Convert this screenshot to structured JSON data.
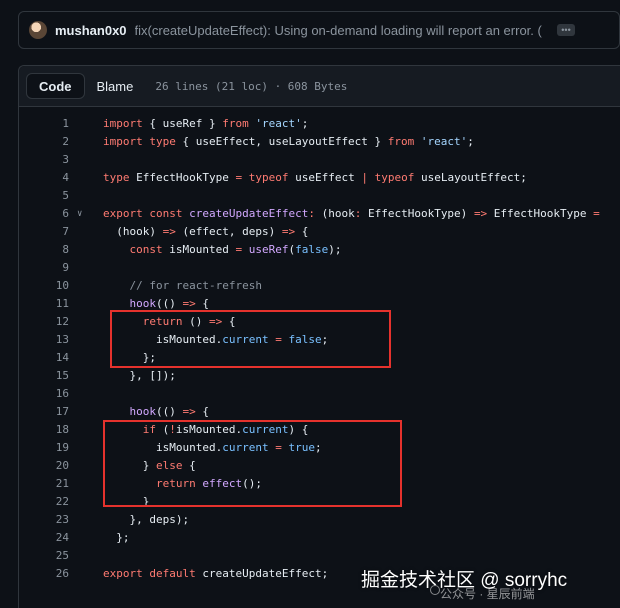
{
  "commit": {
    "author": "mushan0x0",
    "message": "fix(createUpdateEffect): Using on-demand loading will report an error. (",
    "more_label": "•••"
  },
  "file": {
    "tabs": [
      {
        "label": "Code",
        "active": true
      },
      {
        "label": "Blame",
        "active": false
      }
    ],
    "meta": "26 lines (21 loc) · 608 Bytes"
  },
  "code": {
    "lines": [
      {
        "n": "1",
        "html": "<span class=\"kw\">import</span> { useRef } <span class=\"kw\">from</span> <span class=\"str\">'react'</span>;"
      },
      {
        "n": "2",
        "html": "<span class=\"kw\">import</span> <span class=\"kw\">type</span> { useEffect, useLayoutEffect } <span class=\"kw\">from</span> <span class=\"str\">'react'</span>;"
      },
      {
        "n": "3",
        "html": ""
      },
      {
        "n": "4",
        "html": "<span class=\"kw\">type</span> EffectHookType <span class=\"kw\">=</span> <span class=\"kw\">typeof</span> useEffect <span class=\"kw\">|</span> <span class=\"kw\">typeof</span> useLayoutEffect;"
      },
      {
        "n": "5",
        "html": ""
      },
      {
        "n": "6",
        "fold": true,
        "html": "<span class=\"kw\">export</span> <span class=\"kw\">const</span> <span class=\"fn\">createUpdateEffect</span><span class=\"kw\">:</span> (hook<span class=\"kw\">:</span> EffectHookType) <span class=\"kw\">=&gt;</span> EffectHookType <span class=\"kw\">=</span>"
      },
      {
        "n": "7",
        "html": "  (hook) <span class=\"kw\">=&gt;</span> (effect, deps) <span class=\"kw\">=&gt;</span> {"
      },
      {
        "n": "8",
        "html": "    <span class=\"kw\">const</span> isMounted <span class=\"kw\">=</span> <span class=\"fn\">useRef</span>(<span class=\"cn\">false</span>);"
      },
      {
        "n": "9",
        "html": ""
      },
      {
        "n": "10",
        "html": "    <span class=\"cm\">// for react-refresh</span>"
      },
      {
        "n": "11",
        "html": "    <span class=\"fn\">hook</span>(() <span class=\"kw\">=&gt;</span> {"
      },
      {
        "n": "12",
        "html": "      <span class=\"kw\">return</span> () <span class=\"kw\">=&gt;</span> {"
      },
      {
        "n": "13",
        "html": "        isMounted.<span class=\"cn\">current</span> <span class=\"kw\">=</span> <span class=\"cn\">false</span>;"
      },
      {
        "n": "14",
        "html": "      };"
      },
      {
        "n": "15",
        "html": "    }, []);"
      },
      {
        "n": "16",
        "html": ""
      },
      {
        "n": "17",
        "html": "    <span class=\"fn\">hook</span>(() <span class=\"kw\">=&gt;</span> {"
      },
      {
        "n": "18",
        "html": "      <span class=\"kw\">if</span> (<span class=\"kw\">!</span>isMounted.<span class=\"cn\">current</span>) {"
      },
      {
        "n": "19",
        "html": "        isMounted.<span class=\"cn\">current</span> <span class=\"kw\">=</span> <span class=\"cn\">true</span>;"
      },
      {
        "n": "20",
        "html": "      } <span class=\"kw\">else</span> {"
      },
      {
        "n": "21",
        "html": "        <span class=\"kw\">return</span> <span class=\"fn\">effect</span>();"
      },
      {
        "n": "22",
        "html": "      }"
      },
      {
        "n": "23",
        "html": "    }, deps);"
      },
      {
        "n": "24",
        "html": "  };"
      },
      {
        "n": "25",
        "html": ""
      },
      {
        "n": "26",
        "html": "<span class=\"kw\">export</span> <span class=\"kw\">default</span> createUpdateEffect;"
      }
    ]
  },
  "watermark": {
    "main": "掘金技术社区 @ sorryhc",
    "sub": "公众号 · 星辰前端"
  },
  "colors": {
    "background": "#0d1117",
    "border": "#30363d",
    "keyword": "#ff7b72",
    "string": "#a5d6ff",
    "function": "#d2a8ff",
    "constant": "#79c0ff",
    "highlight_box": "#e5322d"
  }
}
